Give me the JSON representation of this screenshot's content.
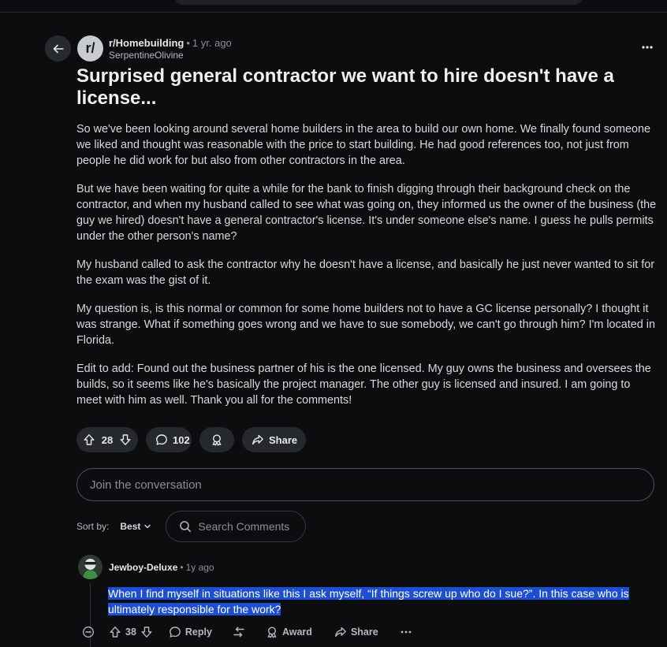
{
  "post": {
    "subreddit": "r/Homebuilding",
    "age": "1 yr. ago",
    "author": "SerpentineOlivine",
    "avatar_text": "r/",
    "title": "Surprised general contractor we want to hire doesn't have a license...",
    "paragraphs": [
      "So we've been looking around several home builders in the area to build our own home. We finally found someone we liked and thought was reasonable with the price to start building. He had good references too, not just from people he did work for but also from other contractors in the area.",
      "But we have been waiting for quite a while for the bank to finish digging through their background check on the contractor, and when my husband called to see what was going on, they informed us the owner of the business (the guy we hired) doesn't have a general contractor's license. It's under someone else's name. I guess he pulls permits under the other person's name?",
      "My husband called to ask the contractor why he doesn't have a license, and basically he just never wanted to sit for the exam was the gist of it.",
      "My question is, is this normal or common for some home builders not to have a GC license personally? I thought it was strange. What if something goes wrong and we have to sue somebody, we can't go through him? I'm located in Florida.",
      "Edit to add: Found out the business partner of his is the one licensed. My guy owns the business and oversees the builds, so it seems like he's basically the project manager. The other guy is licensed and insured. I am going to meet with him as well. Thank you all for the comments!"
    ],
    "vote_count": "28",
    "comment_count": "102",
    "share_label": "Share"
  },
  "composer": {
    "placeholder": "Join the conversation"
  },
  "sort": {
    "label": "Sort by:",
    "value": "Best",
    "search_placeholder": "Search Comments"
  },
  "comments": [
    {
      "username": "Jewboy-Deluxe",
      "age": "1y ago",
      "text": "When I find myself in situations like this I ask myself, “If things screw up who do I sue?”. In this case who is ultimately responsible for the work?",
      "votes": "38",
      "reply_label": "Reply",
      "award_label": "Award",
      "share_label": "Share"
    }
  ],
  "colors": {
    "background": "#0b0d0e",
    "pill": "#26292b",
    "selection": "#1d4fd3"
  }
}
